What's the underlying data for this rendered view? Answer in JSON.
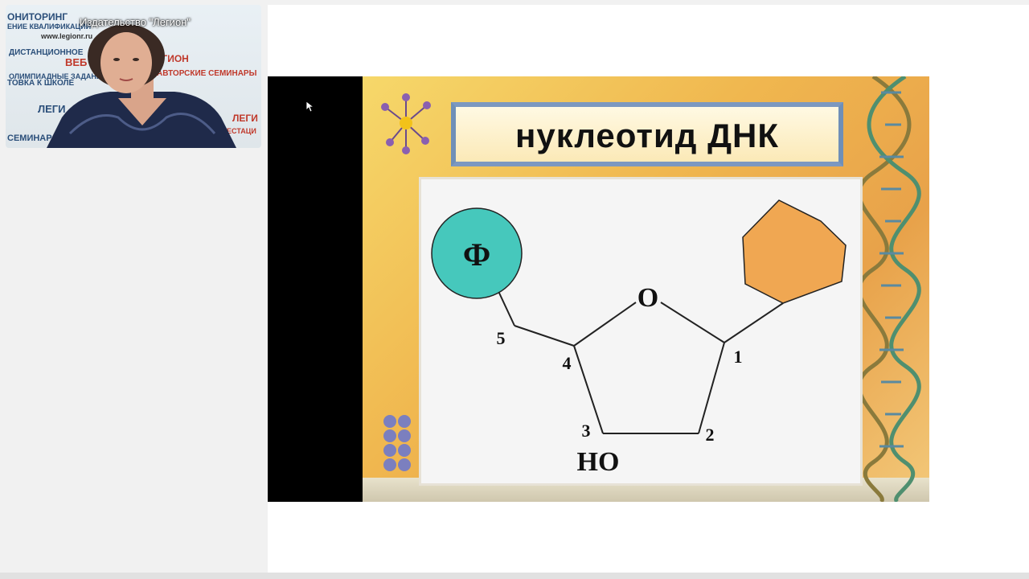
{
  "webcam": {
    "caption": "Издательство \"Легион\"",
    "watermarks": [
      "ОНИТОРИНГ",
      "ЕНИЕ КВАЛИФИКАЦИИ",
      "www.legionr.ru",
      "ДИСТАНЦИОННОЕ",
      "ВЕБ",
      "ЛЕГИОН",
      "ОЛИМПИАДНЫЕ ЗАДАНИ",
      "АВТОРСКИЕ СЕМИНАРЫ",
      "ТОВКА К ШКОЛЕ",
      "ЛЕГИ",
      "АТТЕСТАЦИ",
      "СЕМИНАР",
      "ЛЕГИ"
    ]
  },
  "slide": {
    "title": "нуклеотид ДНК",
    "diagram": {
      "phosphate_label": "Ф",
      "oxygen_label": "О",
      "hydroxyl_label": "HO",
      "carbon_labels": [
        "1",
        "2",
        "3",
        "4",
        "5"
      ]
    }
  },
  "colors": {
    "phosphate_fill": "#46c8bc",
    "base_fill": "#f0a752",
    "slide_bg": "#f0b74f"
  }
}
